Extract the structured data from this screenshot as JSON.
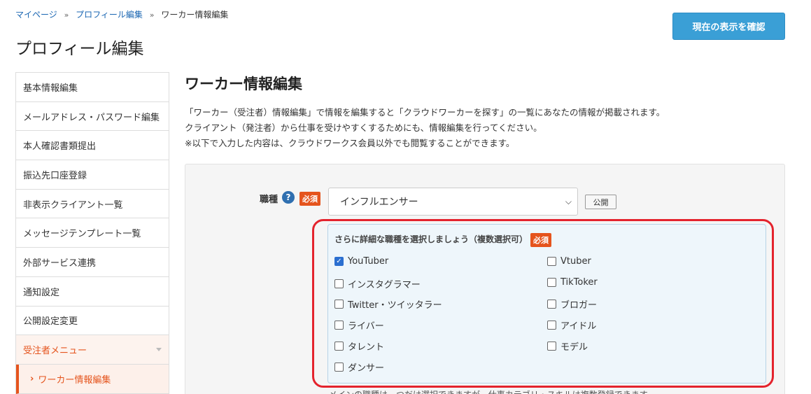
{
  "breadcrumb": [
    "マイページ",
    "プロフィール編集",
    "ワーカー情報編集"
  ],
  "page_title": "プロフィール編集",
  "confirm_button": "現在の表示を確認",
  "sidebar": {
    "items": [
      "基本情報編集",
      "メールアドレス・パスワード編集",
      "本人確認書類提出",
      "振込先口座登録",
      "非表示クライアント一覧",
      "メッセージテンプレート一覧",
      "外部サービス連携",
      "通知設定",
      "公開設定変更"
    ],
    "section": "受注者メニュー",
    "active_item": "ワーカー情報編集"
  },
  "main": {
    "title": "ワーカー情報編集",
    "desc1": "「ワーカー（受注者）情報編集」で情報を編集すると「クラウドワーカーを探す」の一覧にあなたの情報が掲載されます。",
    "desc2": "クライアント（発注者）から仕事を受けやすくするためにも、情報編集を行ってください。",
    "desc3": "※以下で入力した内容は、クラウドワークス会員以外でも閲覧することができます。"
  },
  "form": {
    "job_label": "職種",
    "help_icon": "?",
    "required": "必須",
    "job_select_value": "インフルエンサー",
    "public_button": "公開",
    "sub_title": "さらに詳細な職種を選択しましょう（複数選択可）",
    "options": [
      {
        "label": "YouTuber",
        "checked": true
      },
      {
        "label": "Vtuber",
        "checked": false
      },
      {
        "label": "インスタグラマー",
        "checked": false
      },
      {
        "label": "TikToker",
        "checked": false
      },
      {
        "label": "Twitter・ツイッタラー",
        "checked": false
      },
      {
        "label": "ブロガー",
        "checked": false
      },
      {
        "label": "ライバー",
        "checked": false
      },
      {
        "label": "アイドル",
        "checked": false
      },
      {
        "label": "タレント",
        "checked": false
      },
      {
        "label": "モデル",
        "checked": false
      },
      {
        "label": "ダンサー",
        "checked": false
      }
    ],
    "note": "メインの職種は一つだけ選択できますが、仕事カテゴリ・スキルは複数登録できます。"
  },
  "colors": {
    "accent": "#e5541d",
    "button_blue": "#3a9fd6",
    "highlight_red": "#e4232d"
  }
}
